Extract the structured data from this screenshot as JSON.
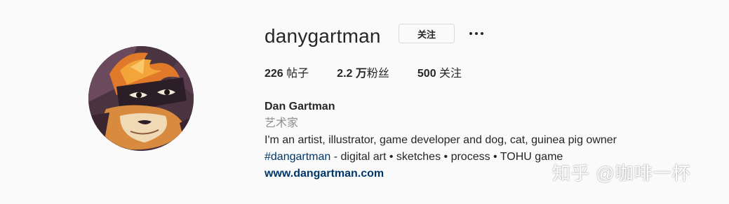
{
  "profile": {
    "username": "danygartman",
    "follow_label": "关注",
    "more_icon": "more-horizontal-icon",
    "stats": {
      "posts_count": "226",
      "posts_label": "帖子",
      "followers_count": "2.2 万",
      "followers_label": "粉丝",
      "following_count": "500",
      "following_label": "关注"
    },
    "bio": {
      "name": "Dan Gartman",
      "category": "艺术家",
      "line1": "I'm an artist, illustrator, game developer and dog, cat, guinea pig owner",
      "hashtag": "#dangartman",
      "line2_rest": " - digital art • sketches • process • TOHU game",
      "website": "www.dangartman.com"
    }
  },
  "watermark": "知乎 @咖啡一杯",
  "colors": {
    "background": "#fafafa",
    "text": "#262626",
    "secondary": "#8e8e8e",
    "link": "#00376b",
    "border": "#dbdbdb"
  }
}
